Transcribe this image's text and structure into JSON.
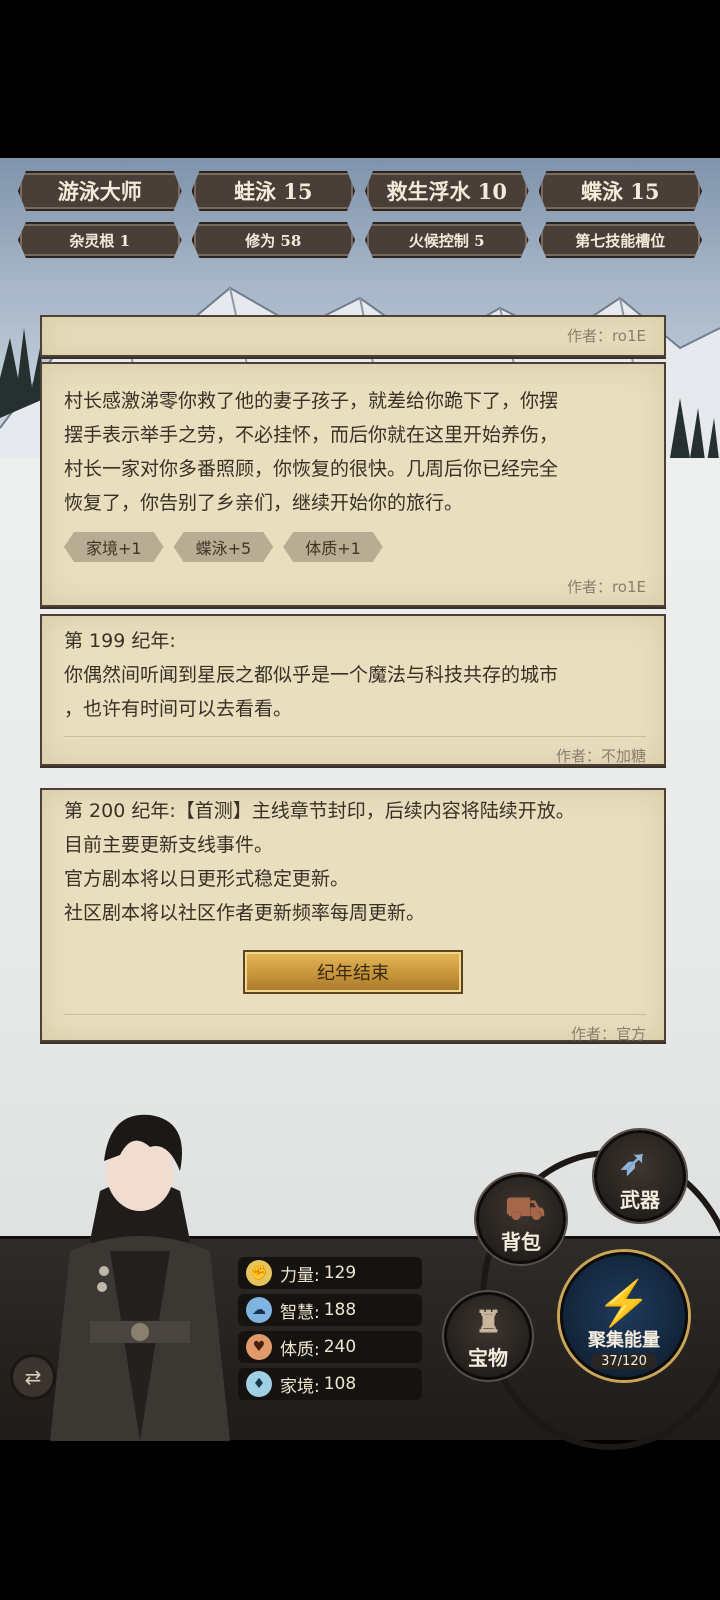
{
  "badges_top": [
    "游泳大师",
    "蛙泳 15",
    "救生浮水 10",
    "蝶泳 15"
  ],
  "badges_bottom": [
    "杂灵根 1",
    "修为 58",
    "火候控制 5",
    "第七技能槽位"
  ],
  "cards": {
    "c0": {
      "author": "作者：ro1E"
    },
    "c1": {
      "lines": [
        "村长感激涕零你救了他的妻子孩子，就差给你跪下了，你摆",
        "摆手表示举手之劳，不必挂怀，而后你就在这里开始养伤，",
        "村长一家对你多番照顾，你恢复的很快。几周后你已经完全",
        "恢复了，你告别了乡亲们，继续开始你的旅行。"
      ],
      "tags": [
        "家境+1",
        "蝶泳+5",
        "体质+1"
      ],
      "author": "作者：ro1E"
    },
    "c2": {
      "lines": [
        "第 199 纪年:",
        "你偶然间听闻到星辰之都似乎是一个魔法与科技共存的城市",
        "，也许有时间可以去看看。"
      ],
      "author": "作者：不加糖"
    },
    "c3": {
      "lines": [
        "第 200 纪年:【首测】主线章节封印，后续内容将陆续开放。",
        "目前主要更新支线事件。",
        "官方剧本将以日更形式稳定更新。",
        "社区剧本将以社区作者更新频率每周更新。"
      ],
      "button": "纪年结束",
      "author": "作者：官方"
    }
  },
  "stats": [
    {
      "icon": "fist-icon",
      "label": "力量:",
      "value": "129",
      "color": "#e8c25a"
    },
    {
      "icon": "brain-icon",
      "label": "智慧:",
      "value": "188",
      "color": "#7fb4e0"
    },
    {
      "icon": "muscle-icon",
      "label": "体质:",
      "value": "240",
      "color": "#e39a6a"
    },
    {
      "icon": "diamond-icon",
      "label": "家境:",
      "value": "108",
      "color": "#9fd0e6"
    }
  ],
  "actions": {
    "weapon": "武器",
    "bag": "背包",
    "treasure": "宝物",
    "energy_label": "聚集能量",
    "energy_value": "37/120"
  }
}
